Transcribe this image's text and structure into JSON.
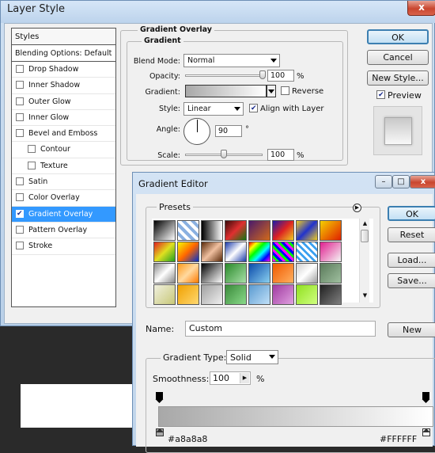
{
  "layer_style": {
    "title": "Layer Style",
    "close_glyph": "x",
    "styles_header": "Styles",
    "blending_options": "Blending Options: Default",
    "style_items": [
      {
        "label": "Drop Shadow",
        "checked": false,
        "indent": false
      },
      {
        "label": "Inner Shadow",
        "checked": false,
        "indent": false
      },
      {
        "label": "Outer Glow",
        "checked": false,
        "indent": false
      },
      {
        "label": "Inner Glow",
        "checked": false,
        "indent": false
      },
      {
        "label": "Bevel and Emboss",
        "checked": false,
        "indent": false
      },
      {
        "label": "Contour",
        "checked": false,
        "indent": true
      },
      {
        "label": "Texture",
        "checked": false,
        "indent": true
      },
      {
        "label": "Satin",
        "checked": false,
        "indent": false
      },
      {
        "label": "Color Overlay",
        "checked": false,
        "indent": false
      },
      {
        "label": "Gradient Overlay",
        "checked": true,
        "indent": false,
        "selected": true
      },
      {
        "label": "Pattern Overlay",
        "checked": false,
        "indent": false
      },
      {
        "label": "Stroke",
        "checked": false,
        "indent": false
      }
    ],
    "panel": {
      "section_title": "Gradient Overlay",
      "group_title": "Gradient",
      "blend_mode_label": "Blend Mode:",
      "blend_mode_value": "Normal",
      "opacity_label": "Opacity:",
      "opacity_value": "100",
      "opacity_unit": "%",
      "opacity_level": 1.0,
      "gradient_label": "Gradient:",
      "reverse_label": "Reverse",
      "reverse_checked": false,
      "style_label": "Style:",
      "style_value": "Linear",
      "align_label": "Align with Layer",
      "align_checked": true,
      "angle_label": "Angle:",
      "angle_value": "90",
      "angle_unit": "°",
      "scale_label": "Scale:",
      "scale_value": "100",
      "scale_unit": "%",
      "scale_level": 0.5
    },
    "buttons": {
      "ok": "OK",
      "cancel": "Cancel",
      "new_style": "New Style...",
      "preview": "Preview",
      "preview_checked": true
    }
  },
  "gradient_editor": {
    "title": "Gradient Editor",
    "presets_label": "Presets",
    "buttons": {
      "ok": "OK",
      "reset": "Reset",
      "load": "Load...",
      "save": "Save...",
      "new": "New"
    },
    "name_label": "Name:",
    "name_value": "Custom",
    "gradient_type_label": "Gradient Type:",
    "gradient_type_value": "Solid",
    "smoothness_label": "Smoothness:",
    "smoothness_value": "100",
    "smoothness_unit": "%",
    "start_color": "#a8a8a8",
    "end_color": "#FFFFFF",
    "presets": [
      [
        "linear-gradient(135deg,#000,#fff)",
        "repeating-linear-gradient(45deg,#fff 0 4px,#8ab0e0 4px 8px)",
        "linear-gradient(90deg,#000,#fff)",
        "linear-gradient(135deg,#3a0a0a,#e03030,#117711)",
        "linear-gradient(135deg,#4a1a6a,#d26a1a)",
        "linear-gradient(135deg,#1a1aaa,#dd2222,#eecc22)",
        "linear-gradient(135deg,#eecc22,#2233cc,#eecc22)",
        "linear-gradient(135deg,#f5d000,#e02000)"
      ],
      [
        "linear-gradient(135deg,#e02020,#e0e020,#20a020)",
        "linear-gradient(135deg,#f7f700,#ff6600,#0033cc)",
        "linear-gradient(135deg,#5a2a0a,#f0c0a0,#5a2a0a)",
        "linear-gradient(135deg,#1a3aaa,#fff,#1a3aaa)",
        "linear-gradient(135deg,#f00,#ff0,#0f0,#0ff,#00f,#f0f)",
        "repeating-linear-gradient(45deg,#f0f 0 3px,#0f0 3px 6px,#00f 6px 9px)",
        "repeating-linear-gradient(45deg,#fff 0 3px,#3aa0f0 3px 6px)",
        "linear-gradient(135deg,#e02090,#f5f5f5)"
      ],
      [
        "linear-gradient(135deg,#888,#fff,#888)",
        "linear-gradient(135deg,#ff9a1a,#ffd9a0,#ff7a00)",
        "linear-gradient(135deg,#000,#888,#fff)",
        "linear-gradient(135deg,#2a8a2a,#a8e0a8)",
        "linear-gradient(135deg,#0a4aaa,#8ad0f0)",
        "linear-gradient(135deg,#f05a00,#ffb060)",
        "linear-gradient(135deg,#d0d0d0,#fff,#a0a0a0)",
        "linear-gradient(135deg,#5a7a5a,#a0c0a0)"
      ],
      [
        "linear-gradient(135deg,#f0f0e0,#c8c878)",
        "linear-gradient(135deg,#f0a000,#ffd870)",
        "linear-gradient(135deg,#a0a0a0,#f0f0f0)",
        "linear-gradient(135deg,#3a8a3a,#8ada8a)",
        "linear-gradient(135deg,#5a9ad0,#c0e0f8)",
        "linear-gradient(135deg,#a03aa0,#e0a0e0)",
        "linear-gradient(135deg,#90e020,#d0ff80)",
        "linear-gradient(135deg,#202020,#808080)"
      ]
    ]
  }
}
